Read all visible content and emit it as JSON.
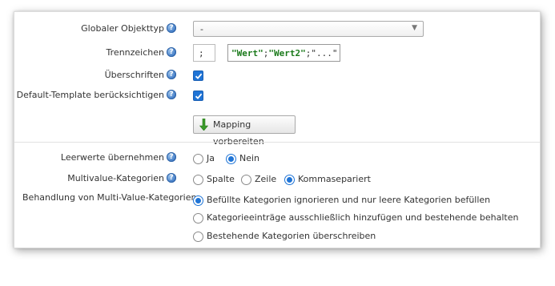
{
  "settings": {
    "global_object_type": {
      "label": "Globaler Objekttyp",
      "value": "-"
    },
    "separator": {
      "label": "Trennzeichen",
      "value": ";",
      "example": [
        "\"Wert\"",
        ";",
        "\"Wert2\"",
        ";\"...\""
      ]
    },
    "headings": {
      "label": "Überschriften",
      "checked": true
    },
    "default_template": {
      "label": "Default-Template berücksichtigen",
      "checked": true
    },
    "prepare_mapping_button": "Mapping vorbereiten"
  },
  "options": {
    "empty_values": {
      "label": "Leerwerte übernehmen",
      "choices": [
        "Ja",
        "Nein"
      ],
      "selected": "Nein"
    },
    "multivalue_categories": {
      "label": "Multivalue-Kategorien",
      "choices": [
        "Spalte",
        "Zeile",
        "Kommasepariert"
      ],
      "selected": "Kommasepariert"
    },
    "multivalue_handling": {
      "label": "Behandlung von Multi-Value-Kategorien",
      "choices": [
        "Befüllte Kategorien ignorieren und nur leere Kategorien befüllen",
        "Kategorieeinträge ausschließlich hinzufügen und bestehende behalten",
        "Bestehende Kategorien überschreiben"
      ],
      "selected": "Befüllte Kategorien ignorieren und nur leere Kategorien befüllen"
    }
  },
  "icons": {
    "help": "help-icon",
    "check": "checkmark-icon",
    "mapping": "green-down-arrow-icon",
    "dropdown": "chevron-down-icon"
  },
  "help_glyph": "?",
  "colors": {
    "accent": "#1f74d6",
    "help": "#3d78c4",
    "code_keyword": "#1b7a1b"
  }
}
